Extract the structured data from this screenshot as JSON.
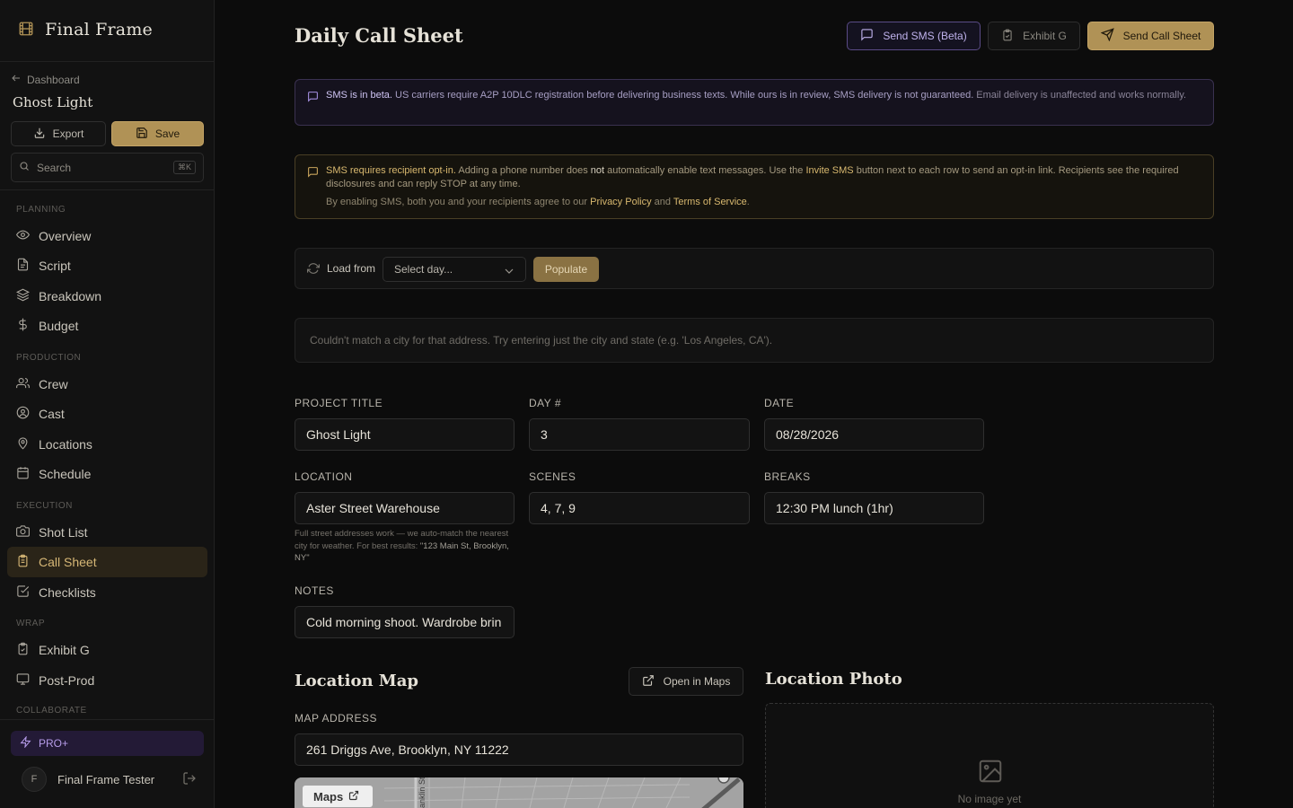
{
  "app": {
    "name": "Final Frame"
  },
  "sidebar": {
    "back_label": "Dashboard",
    "project_name": "Ghost Light",
    "export_label": "Export",
    "save_label": "Save",
    "search_placeholder": "Search",
    "search_shortcut": "⌘K",
    "sections": {
      "planning": "PLANNING",
      "production": "PRODUCTION",
      "execution": "EXECUTION",
      "wrap": "WRAP",
      "collaborate": "COLLABORATE"
    },
    "items": {
      "overview": "Overview",
      "script": "Script",
      "breakdown": "Breakdown",
      "budget": "Budget",
      "crew": "Crew",
      "cast": "Cast",
      "locations": "Locations",
      "schedule": "Schedule",
      "shot_list": "Shot List",
      "call_sheet": "Call Sheet",
      "checklists": "Checklists",
      "exhibit_g": "Exhibit G",
      "post_prod": "Post-Prod"
    },
    "active_item": "Call Sheet",
    "pro_label": "PRO+",
    "user": {
      "initial": "F",
      "name": "Final Frame Tester"
    }
  },
  "header": {
    "title": "Daily Call Sheet",
    "sms_button": "Send SMS (Beta)",
    "exhibit_button": "Exhibit G",
    "send_button": "Send Call Sheet"
  },
  "banners": {
    "beta": {
      "strong": "SMS is in beta.",
      "body": " US carriers require A2P 10DLC registration before delivering business texts. While ours is in review, SMS delivery is not guaranteed.",
      "dim": " Email delivery is unaffected and works normally."
    },
    "optin": {
      "strong": "SMS requires recipient opt-in.",
      "part1": " Adding a phone number does ",
      "not": "not",
      "part2": " automatically enable text messages. Use the ",
      "invite": "Invite SMS",
      "part3": " button next to each row to send an opt-in link. Recipients see the required disclosures and can reply STOP at any time.",
      "sub_prefix": "By enabling SMS, both you and your recipients agree to our ",
      "privacy": "Privacy Policy",
      "and": " and ",
      "terms": "Terms of Service",
      "period": "."
    }
  },
  "load_from": {
    "label": "Load from",
    "select_value": "Select day...",
    "populate_label": "Populate"
  },
  "geocode_message": "Couldn't match a city for that address. Try entering just the city and state (e.g. 'Los Angeles, CA').",
  "form": {
    "project_title": {
      "label": "PROJECT TITLE",
      "value": "Ghost Light"
    },
    "day": {
      "label": "DAY #",
      "value": "3"
    },
    "date": {
      "label": "DATE",
      "value": "08/28/2026"
    },
    "location": {
      "label": "LOCATION",
      "value": "Aster Street Warehouse",
      "help": "Full street addresses work — we auto-match the nearest city for weather. For best results: ",
      "help_example": "\"123 Main St, Brooklyn, NY\""
    },
    "scenes": {
      "label": "SCENES",
      "value": "4, 7, 9"
    },
    "breaks": {
      "label": "BREAKS",
      "value": "12:30 PM lunch (1hr)"
    },
    "notes": {
      "label": "NOTES",
      "value": "Cold morning shoot. Wardrobe brin"
    }
  },
  "location_map": {
    "title": "Location Map",
    "open_maps_label": "Open in Maps",
    "address_label": "MAP ADDRESS",
    "address_value": "261 Driggs Ave, Brooklyn, NY 11222",
    "maps_tag": "Maps",
    "street_label": "anklin St"
  },
  "location_photo": {
    "title": "Location Photo",
    "empty_text": "No image yet"
  },
  "colors": {
    "accent_gold": "#b09256",
    "beta_purple": "#5a4b86",
    "background": "#0c0c0c"
  }
}
